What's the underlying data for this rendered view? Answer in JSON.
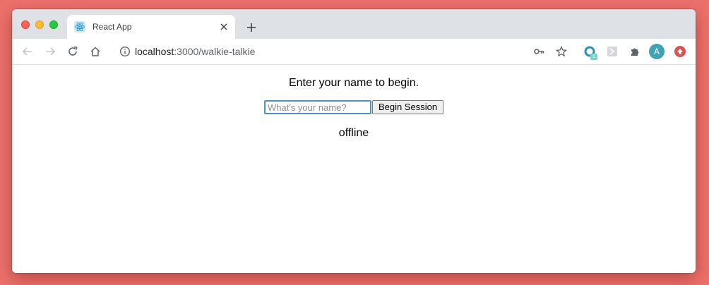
{
  "browser": {
    "tab": {
      "title": "React App",
      "favicon": "react-icon"
    },
    "address": {
      "host": "localhost",
      "path": ":3000/walkie-talkie"
    },
    "profile_initial": "A",
    "extension_badge": "1"
  },
  "page": {
    "heading": "Enter your name to begin.",
    "name_input": {
      "value": "",
      "placeholder": "What's your name?"
    },
    "begin_button": "Begin Session",
    "status": "offline"
  },
  "colors": {
    "background": "#ec706b",
    "input_focus": "#4d90c7",
    "avatar": "#3fa2b5",
    "update": "#d9534f"
  }
}
